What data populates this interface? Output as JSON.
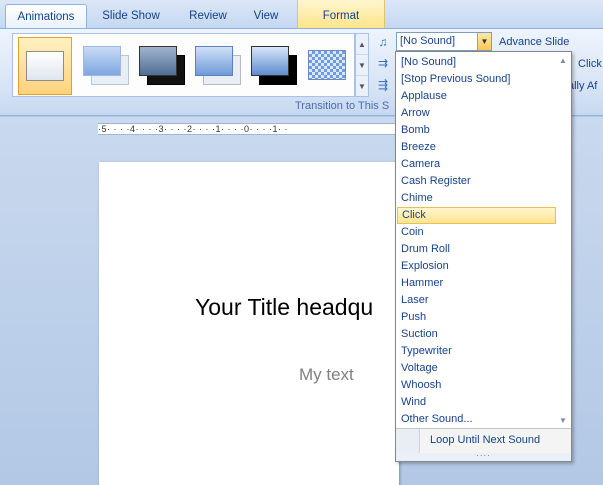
{
  "tabs": {
    "animations": "Animations",
    "slide_show": "Slide Show",
    "review": "Review",
    "view": "View",
    "format": "Format"
  },
  "ribbon": {
    "group_label": "Transition to This S",
    "advance_slide": "Advance Slide",
    "partial_click": "Click",
    "partial_after": "ally Af"
  },
  "ruler_text": "·5· · · ·4· · · ·3· · · ·2· · · ·1· · · ·0· · · ·1· ·",
  "slide": {
    "title": "Your Title headqu",
    "text": "My text"
  },
  "sound": {
    "selected": "[No Sound]",
    "items": [
      "[No Sound]",
      "[Stop Previous Sound]",
      "Applause",
      "Arrow",
      "Bomb",
      "Breeze",
      "Camera",
      "Cash Register",
      "Chime",
      "Click",
      "Coin",
      "Drum Roll",
      "Explosion",
      "Hammer",
      "Laser",
      "Push",
      "Suction",
      "Typewriter",
      "Voltage",
      "Whoosh",
      "Wind",
      "Other Sound..."
    ],
    "highlighted_index": 9,
    "loop_label": "Loop Until Next Sound"
  },
  "colors": {
    "accent_text": "#15428b",
    "highlight": "#ffe38f",
    "ribbon_bg": "#d6e3f5"
  }
}
